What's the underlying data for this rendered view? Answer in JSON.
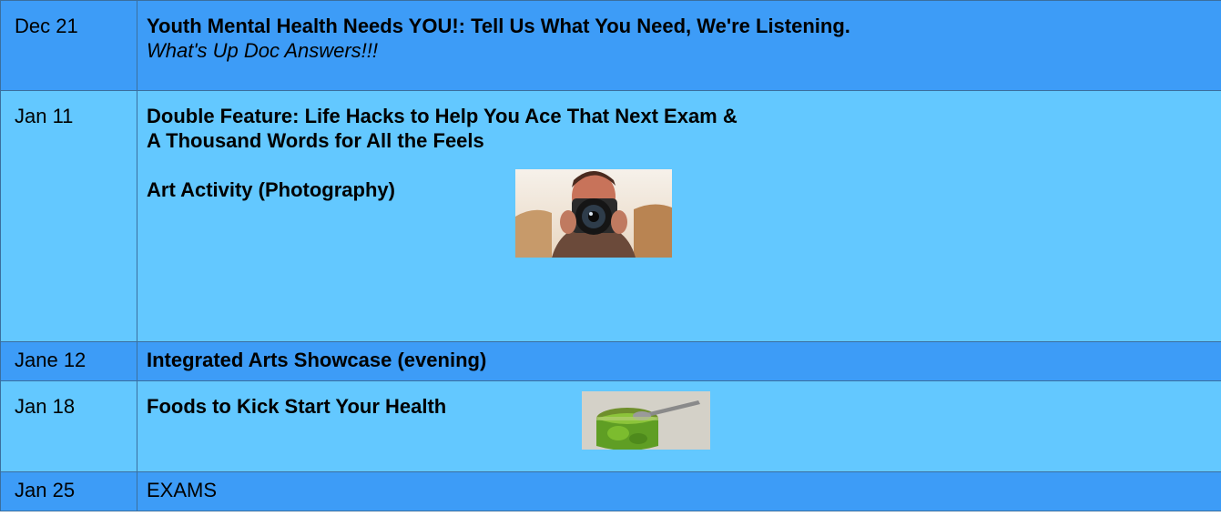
{
  "rows": [
    {
      "date": "Dec 21",
      "title": "Youth Mental Health Needs YOU!: Tell Us What You Need, We're Listening.",
      "subtitle": "What's Up Doc Answers!!!"
    },
    {
      "date": "Jan 11",
      "title_line1": "Double Feature: Life Hacks to Help You Ace That Next Exam &",
      "title_line2": "A Thousand Words for All the Feels",
      "activity": "Art Activity (Photography)"
    },
    {
      "date": "Jane 12",
      "title": "Integrated Arts Showcase (evening)"
    },
    {
      "date": "Jan 18",
      "title": "Foods to Kick Start Your Health"
    },
    {
      "date": "Jan 25",
      "title": "EXAMS"
    }
  ],
  "colors": {
    "dark_row": "#3d9cf7",
    "light_row": "#63c8ff",
    "border": "#3b6f9e"
  },
  "images": {
    "photographer": "photographer-with-camera-image",
    "pesto": "green-pesto-jar-image"
  }
}
